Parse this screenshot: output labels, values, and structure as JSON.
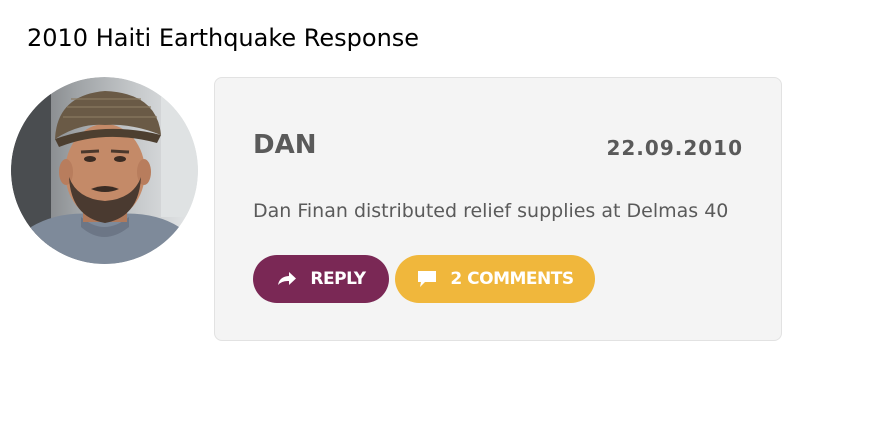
{
  "page": {
    "title": "2010 Haiti Earthquake Response"
  },
  "post": {
    "author": "DAN",
    "date": "22.09.2010",
    "message": "Dan Finan distributed relief supplies at Delmas 40"
  },
  "actions": {
    "reply_label": "REPLY",
    "comments_label": "2 COMMENTS",
    "reply_icon": "share-arrow-icon",
    "comments_icon": "speech-bubble-icon"
  },
  "colors": {
    "reply_button": "#7a2855",
    "comments_button": "#f0b73c",
    "card_background": "#f4f4f4",
    "text": "#5a5a5a"
  }
}
